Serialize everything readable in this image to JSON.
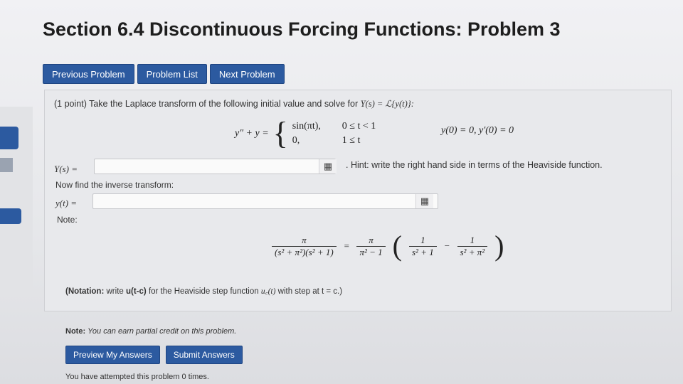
{
  "page": {
    "title": "Section 6.4 Discontinuous Forcing Functions: Problem 3"
  },
  "nav": {
    "previous": "Previous Problem",
    "list": "Problem List",
    "next": "Next Problem"
  },
  "problem": {
    "points": "(1 point)",
    "instruction": "Take the Laplace transform of the following initial value and solve for",
    "ys_def": "Y(s) = ℒ{y(t)}:",
    "ode_lhs": "y″ + y =",
    "case1_expr": "sin(πt),",
    "case1_cond": "0 ≤ t < 1",
    "case2_expr": "0,",
    "case2_cond": "1 ≤ t",
    "initial_conditions": "y(0) = 0,  y′(0) = 0"
  },
  "answers": {
    "ys_label": "Y(s) =",
    "ys_value": "",
    "hint": ". Hint: write the right hand side in terms of the Heaviside function.",
    "inverse_prompt": "Now find the inverse transform:",
    "yt_label": "y(t) =",
    "yt_value": "",
    "note_label": "Note:",
    "grid_icon": "grid-icon"
  },
  "formula": {
    "lhs_num": "π",
    "lhs_den": "(s² + π²)(s² + 1)",
    "eq": "=",
    "coef_num": "π",
    "coef_den": "π² − 1",
    "t1_num": "1",
    "t1_den": "s² + 1",
    "minus": "−",
    "t2_num": "1",
    "t2_den": "s² + π²"
  },
  "notation": {
    "bold": "(Notation:",
    "text": "write",
    "code": "u(t-c)",
    "rest": "for the Heaviside step function",
    "math": "u꜀(t)",
    "tail": "with step at t = c.)"
  },
  "footer": {
    "note_bold": "Note:",
    "note_text": "You can earn partial credit on this problem.",
    "preview": "Preview My Answers",
    "submit": "Submit Answers",
    "attempts": "You have attempted this problem 0 times."
  }
}
